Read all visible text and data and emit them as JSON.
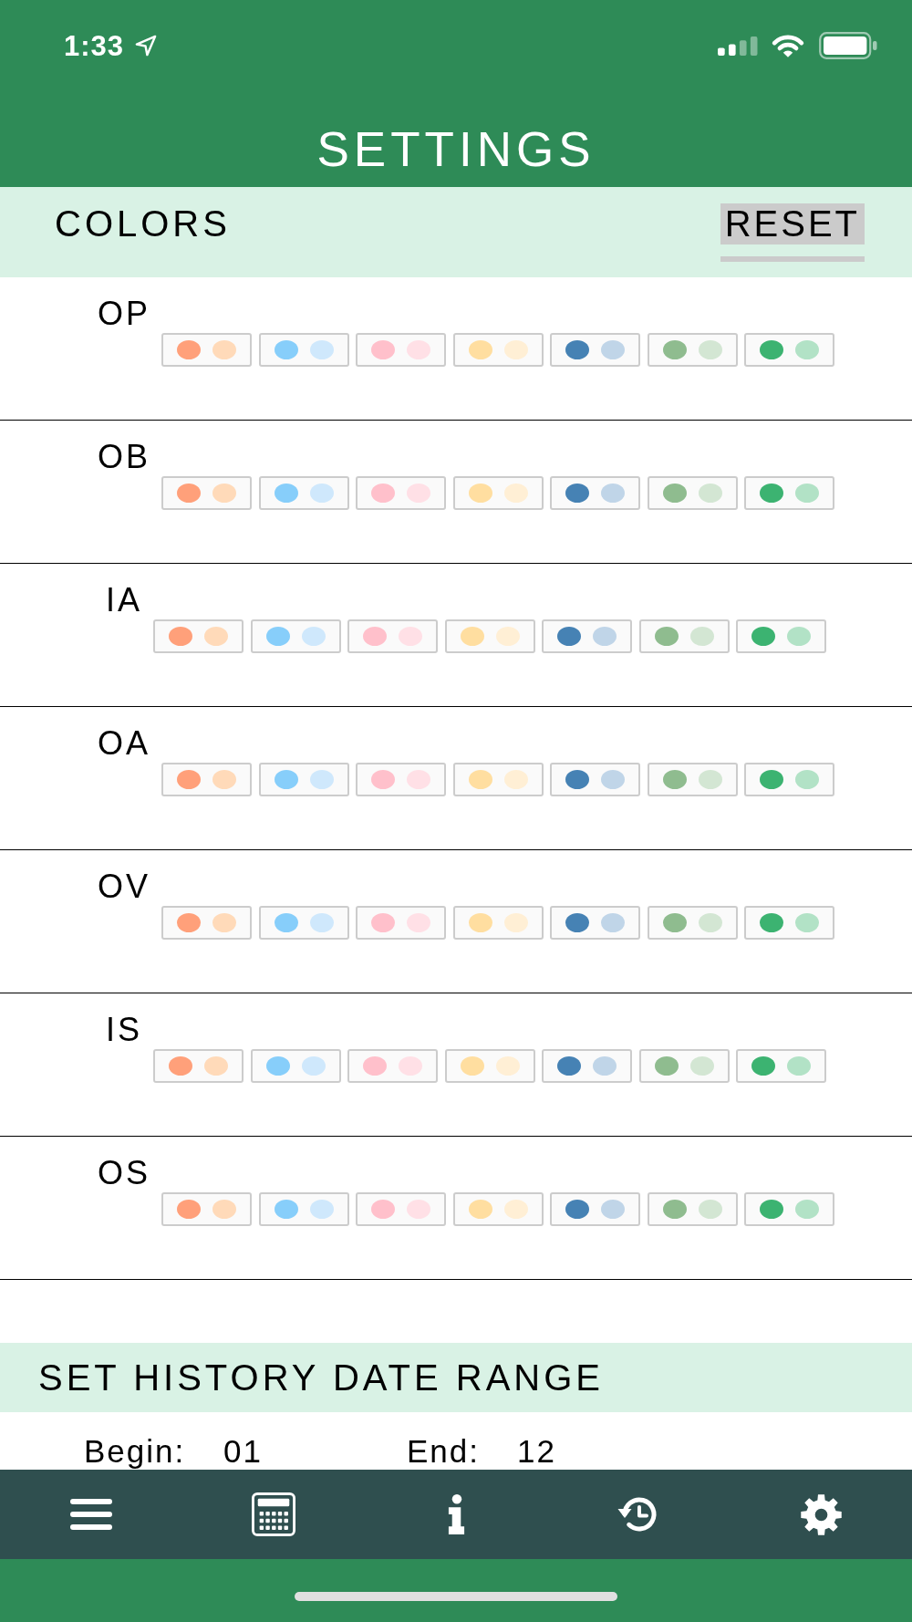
{
  "status_bar": {
    "time": "1:33"
  },
  "header": {
    "title": "SETTINGS"
  },
  "colors_section": {
    "title": "COLORS",
    "reset_button": "RESET"
  },
  "color_rows": [
    {
      "label": "OP",
      "swatches": [
        {
          "dots": [
            {
              "color": "#ffa07a"
            },
            {
              "color": "#ffdab9"
            }
          ]
        },
        {
          "dots": [
            {
              "color": "#87cefa"
            },
            {
              "color": "#cfe8fc"
            }
          ]
        },
        {
          "dots": [
            {
              "color": "#ffc0cb"
            },
            {
              "color": "#ffe0e6"
            }
          ]
        },
        {
          "dots": [
            {
              "color": "#ffdea0"
            },
            {
              "color": "#ffefd5"
            }
          ]
        },
        {
          "dots": [
            {
              "color": "#4682b4"
            },
            {
              "color": "#c0d5e8"
            }
          ]
        },
        {
          "dots": [
            {
              "color": "#8fbc8f"
            },
            {
              "color": "#d3e6d3"
            }
          ]
        },
        {
          "dots": [
            {
              "color": "#3cb371"
            },
            {
              "color": "#b2e2c6"
            }
          ]
        }
      ]
    },
    {
      "label": "OB",
      "swatches": [
        {
          "dots": [
            {
              "color": "#ffa07a"
            },
            {
              "color": "#ffdab9"
            }
          ]
        },
        {
          "dots": [
            {
              "color": "#87cefa"
            },
            {
              "color": "#cfe8fc"
            }
          ]
        },
        {
          "dots": [
            {
              "color": "#ffc0cb"
            },
            {
              "color": "#ffe0e6"
            }
          ]
        },
        {
          "dots": [
            {
              "color": "#ffdea0"
            },
            {
              "color": "#ffefd5"
            }
          ]
        },
        {
          "dots": [
            {
              "color": "#4682b4"
            },
            {
              "color": "#c0d5e8"
            }
          ]
        },
        {
          "dots": [
            {
              "color": "#8fbc8f"
            },
            {
              "color": "#d3e6d3"
            }
          ]
        },
        {
          "dots": [
            {
              "color": "#3cb371"
            },
            {
              "color": "#b2e2c6"
            }
          ]
        }
      ]
    },
    {
      "label": "IA",
      "swatches": [
        {
          "dots": [
            {
              "color": "#ffa07a"
            },
            {
              "color": "#ffdab9"
            }
          ]
        },
        {
          "dots": [
            {
              "color": "#87cefa"
            },
            {
              "color": "#cfe8fc"
            }
          ]
        },
        {
          "dots": [
            {
              "color": "#ffc0cb"
            },
            {
              "color": "#ffe0e6"
            }
          ]
        },
        {
          "dots": [
            {
              "color": "#ffdea0"
            },
            {
              "color": "#ffefd5"
            }
          ]
        },
        {
          "dots": [
            {
              "color": "#4682b4"
            },
            {
              "color": "#c0d5e8"
            }
          ]
        },
        {
          "dots": [
            {
              "color": "#8fbc8f"
            },
            {
              "color": "#d3e6d3"
            }
          ]
        },
        {
          "dots": [
            {
              "color": "#3cb371"
            },
            {
              "color": "#b2e2c6"
            }
          ]
        }
      ]
    },
    {
      "label": "OA",
      "swatches": [
        {
          "dots": [
            {
              "color": "#ffa07a"
            },
            {
              "color": "#ffdab9"
            }
          ]
        },
        {
          "dots": [
            {
              "color": "#87cefa"
            },
            {
              "color": "#cfe8fc"
            }
          ]
        },
        {
          "dots": [
            {
              "color": "#ffc0cb"
            },
            {
              "color": "#ffe0e6"
            }
          ]
        },
        {
          "dots": [
            {
              "color": "#ffdea0"
            },
            {
              "color": "#ffefd5"
            }
          ]
        },
        {
          "dots": [
            {
              "color": "#4682b4"
            },
            {
              "color": "#c0d5e8"
            }
          ]
        },
        {
          "dots": [
            {
              "color": "#8fbc8f"
            },
            {
              "color": "#d3e6d3"
            }
          ]
        },
        {
          "dots": [
            {
              "color": "#3cb371"
            },
            {
              "color": "#b2e2c6"
            }
          ]
        }
      ]
    },
    {
      "label": "OV",
      "swatches": [
        {
          "dots": [
            {
              "color": "#ffa07a"
            },
            {
              "color": "#ffdab9"
            }
          ]
        },
        {
          "dots": [
            {
              "color": "#87cefa"
            },
            {
              "color": "#cfe8fc"
            }
          ]
        },
        {
          "dots": [
            {
              "color": "#ffc0cb"
            },
            {
              "color": "#ffe0e6"
            }
          ]
        },
        {
          "dots": [
            {
              "color": "#ffdea0"
            },
            {
              "color": "#ffefd5"
            }
          ]
        },
        {
          "dots": [
            {
              "color": "#4682b4"
            },
            {
              "color": "#c0d5e8"
            }
          ]
        },
        {
          "dots": [
            {
              "color": "#8fbc8f"
            },
            {
              "color": "#d3e6d3"
            }
          ]
        },
        {
          "dots": [
            {
              "color": "#3cb371"
            },
            {
              "color": "#b2e2c6"
            }
          ]
        }
      ]
    },
    {
      "label": "IS",
      "swatches": [
        {
          "dots": [
            {
              "color": "#ffa07a"
            },
            {
              "color": "#ffdab9"
            }
          ]
        },
        {
          "dots": [
            {
              "color": "#87cefa"
            },
            {
              "color": "#cfe8fc"
            }
          ]
        },
        {
          "dots": [
            {
              "color": "#ffc0cb"
            },
            {
              "color": "#ffe0e6"
            }
          ]
        },
        {
          "dots": [
            {
              "color": "#ffdea0"
            },
            {
              "color": "#ffefd5"
            }
          ]
        },
        {
          "dots": [
            {
              "color": "#4682b4"
            },
            {
              "color": "#c0d5e8"
            }
          ]
        },
        {
          "dots": [
            {
              "color": "#8fbc8f"
            },
            {
              "color": "#d3e6d3"
            }
          ]
        },
        {
          "dots": [
            {
              "color": "#3cb371"
            },
            {
              "color": "#b2e2c6"
            }
          ]
        }
      ]
    },
    {
      "label": "OS",
      "swatches": [
        {
          "dots": [
            {
              "color": "#ffa07a"
            },
            {
              "color": "#ffdab9"
            }
          ]
        },
        {
          "dots": [
            {
              "color": "#87cefa"
            },
            {
              "color": "#cfe8fc"
            }
          ]
        },
        {
          "dots": [
            {
              "color": "#ffc0cb"
            },
            {
              "color": "#ffe0e6"
            }
          ]
        },
        {
          "dots": [
            {
              "color": "#ffdea0"
            },
            {
              "color": "#ffefd5"
            }
          ]
        },
        {
          "dots": [
            {
              "color": "#4682b4"
            },
            {
              "color": "#c0d5e8"
            }
          ]
        },
        {
          "dots": [
            {
              "color": "#8fbc8f"
            },
            {
              "color": "#d3e6d3"
            }
          ]
        },
        {
          "dots": [
            {
              "color": "#3cb371"
            },
            {
              "color": "#b2e2c6"
            }
          ]
        }
      ]
    }
  ],
  "history_section": {
    "title": "SET HISTORY DATE RANGE",
    "begin": {
      "label": "Begin:",
      "value": "01"
    },
    "end": {
      "label": "End:",
      "value": "12"
    }
  }
}
